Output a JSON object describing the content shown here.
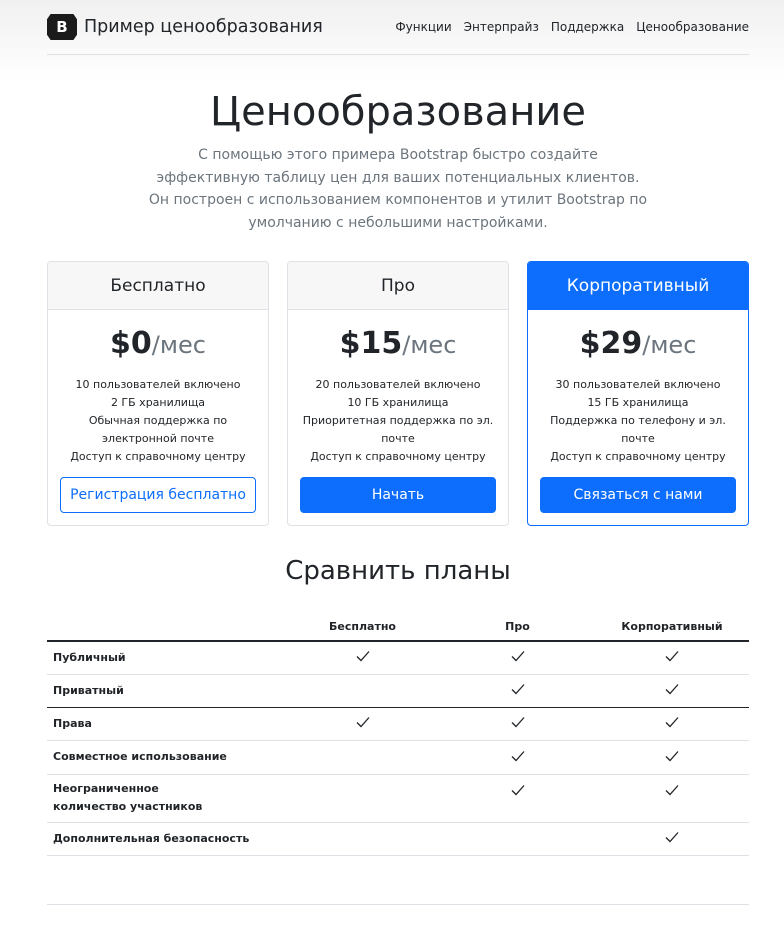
{
  "brand": {
    "logo_letter": "B",
    "name": "Пример ценообразования"
  },
  "nav": [
    "Функции",
    "Энтерпрайз",
    "Поддержка",
    "Ценообразование"
  ],
  "hero": {
    "title": "Ценообразование",
    "lead": "С помощью этого примера Bootstrap быстро создайте эффективную таблицу цен для ваших потенциальных клиентов. Он построен с использованием компонентов и утилит Bootstrap по умолчанию с небольшими настройками."
  },
  "plans": [
    {
      "name": "Бесплатно",
      "price": "$0",
      "per": "/мес",
      "features": [
        "10 пользователей включено",
        "2 ГБ хранилища",
        "Обычная поддержка по электронной почте",
        "Доступ к справочному центру"
      ],
      "button": "Регистрация бесплатно",
      "button_style": "outline"
    },
    {
      "name": "Про",
      "price": "$15",
      "per": "/мес",
      "features": [
        "20 пользователей включено",
        "10 ГБ хранилища",
        "Приоритетная поддержка по эл. почте",
        "Доступ к справочному центру"
      ],
      "button": "Начать",
      "button_style": "solid"
    },
    {
      "name": "Корпоративный",
      "price": "$29",
      "per": "/мес",
      "features": [
        "30 пользователей включено",
        "15 ГБ хранилища",
        "Поддержка по телефону и эл. почте",
        "Доступ к справочному центру"
      ],
      "button": "Связаться с нами",
      "button_style": "solid"
    }
  ],
  "compare": {
    "title": "Сравнить планы",
    "columns": [
      "",
      "Бесплатно",
      "Про",
      "Корпоративный"
    ],
    "rows": [
      {
        "feature": "Публичный",
        "checks": [
          true,
          true,
          true
        ]
      },
      {
        "feature": "Приватный",
        "checks": [
          false,
          true,
          true
        ]
      },
      {
        "feature": "Права",
        "checks": [
          true,
          true,
          true
        ]
      },
      {
        "feature": "Совместное использование",
        "checks": [
          false,
          true,
          true
        ]
      },
      {
        "feature": "Неограниченное количество участников",
        "checks": [
          false,
          true,
          true
        ]
      },
      {
        "feature": "Дополнительная безопасность",
        "checks": [
          false,
          false,
          true
        ]
      }
    ]
  },
  "colors": {
    "primary": "#0d6efd",
    "muted": "#6c757d",
    "text": "#212529",
    "border": "#dee2e6"
  }
}
